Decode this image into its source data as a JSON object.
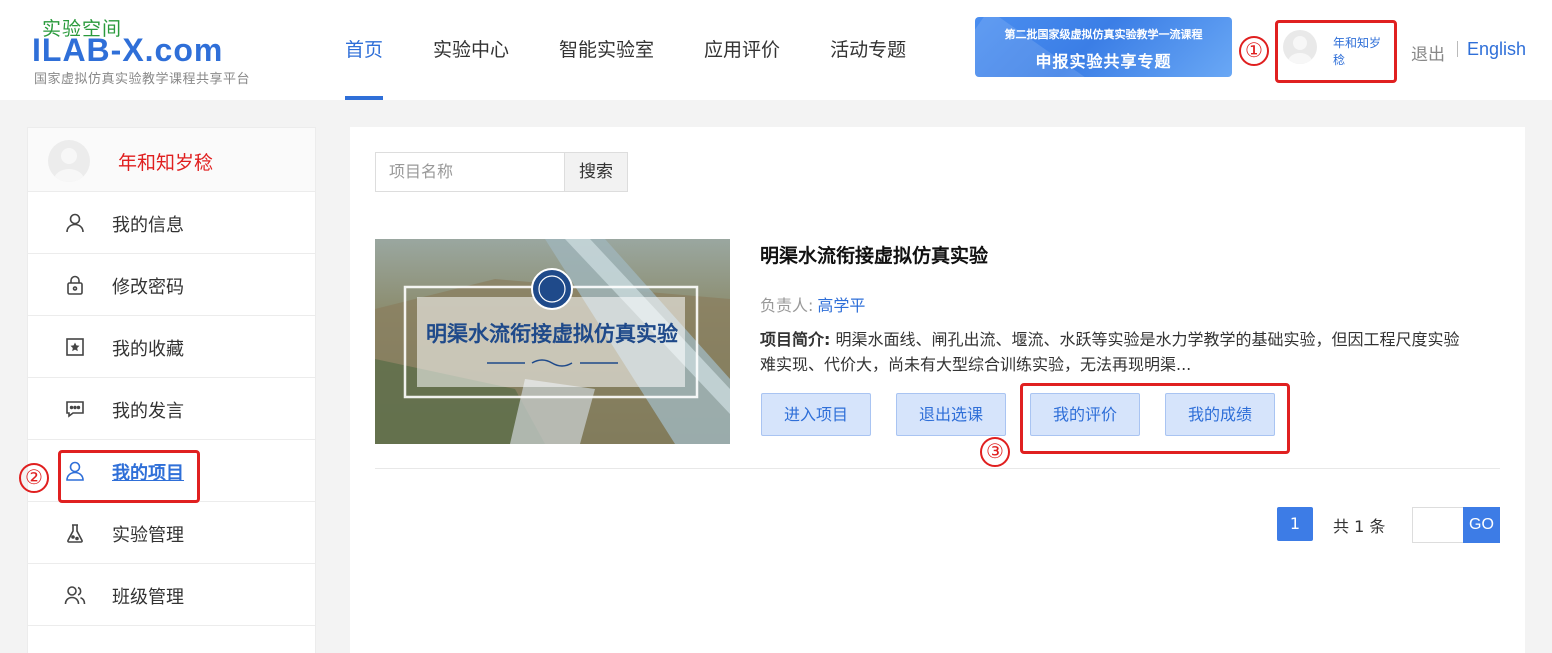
{
  "header": {
    "logo_cn": "实验空间",
    "logo_en": "ILAB-X.com",
    "logo_sub": "国家虚拟仿真实验教学课程共享平台",
    "nav": [
      {
        "label": "首页",
        "active": true
      },
      {
        "label": "实验中心"
      },
      {
        "label": "智能实验室"
      },
      {
        "label": "应用评价"
      },
      {
        "label": "活动专题"
      }
    ],
    "banner_line1": "第二批国家级虚拟仿真实验教学一流课程",
    "banner_line2": "申报实验共享专题",
    "username": "年和知岁稔",
    "logout": "退出",
    "language": "English"
  },
  "annotations": {
    "one": "①",
    "two": "②",
    "three": "③"
  },
  "sidebar": {
    "username": "年和知岁稔",
    "items": [
      {
        "label": "我的信息",
        "icon": "user-icon"
      },
      {
        "label": "修改密码",
        "icon": "lock-icon"
      },
      {
        "label": "我的收藏",
        "icon": "bookmark-star-icon"
      },
      {
        "label": "我的发言",
        "icon": "message-icon"
      },
      {
        "label": "我的项目",
        "icon": "user-icon",
        "active": true
      },
      {
        "label": "实验管理",
        "icon": "flask-icon"
      },
      {
        "label": "班级管理",
        "icon": "users-icon"
      }
    ]
  },
  "search": {
    "placeholder": "项目名称",
    "button": "搜索"
  },
  "project": {
    "image_text": "明渠水流衔接虚拟仿真实验",
    "title": "明渠水流衔接虚拟仿真实验",
    "owner_label": "负责人:",
    "owner": "高学平",
    "intro_label": "项目简介:",
    "intro": "明渠水面线、闸孔出流、堰流、水跃等实验是水力学教学的基础实验，但因工程尺度实验难实现、代价大，尚未有大型综合训练实验，无法再现明渠...",
    "buttons": [
      "进入项目",
      "退出选课",
      "我的评价",
      "我的成绩"
    ]
  },
  "pagination": {
    "current": "1",
    "total": "共 1 条",
    "go": "GO"
  },
  "colors": {
    "accent": "#2f6fd8",
    "highlight": "#e02020"
  }
}
